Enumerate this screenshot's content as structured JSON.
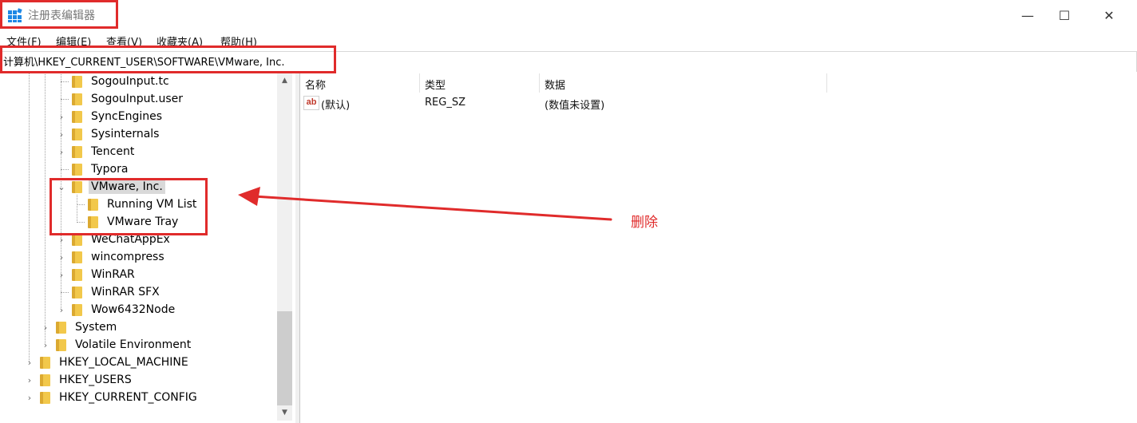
{
  "window": {
    "title": "注册表编辑器",
    "minimize_glyph": "—",
    "maximize_glyph": "☐",
    "close_glyph": "✕"
  },
  "menu": [
    {
      "label": "文件(F)"
    },
    {
      "label": "编辑(E)"
    },
    {
      "label": "查看(V)"
    },
    {
      "label": "收藏夹(A)"
    },
    {
      "label": "帮助(H)"
    }
  ],
  "address": {
    "path": "计算机\\HKEY_CURRENT_USER\\SOFTWARE\\VMware, Inc."
  },
  "tree": {
    "items": [
      {
        "label": "SogouInput.tc",
        "expander": ""
      },
      {
        "label": "SogouInput.user",
        "expander": ""
      },
      {
        "label": "SyncEngines",
        "expander": "›"
      },
      {
        "label": "Sysinternals",
        "expander": "›"
      },
      {
        "label": "Tencent",
        "expander": "›"
      },
      {
        "label": "Typora",
        "expander": ""
      },
      {
        "label": "VMware, Inc.",
        "expander": "⌄",
        "selected": true
      },
      {
        "label": "Running VM List",
        "expander": ""
      },
      {
        "label": "VMware Tray",
        "expander": ""
      },
      {
        "label": "WeChatAppEx",
        "expander": "›"
      },
      {
        "label": "wincompress",
        "expander": "›"
      },
      {
        "label": "WinRAR",
        "expander": "›"
      },
      {
        "label": "WinRAR SFX",
        "expander": ""
      },
      {
        "label": "Wow6432Node",
        "expander": "›"
      },
      {
        "label": "System",
        "expander": "›"
      },
      {
        "label": "Volatile Environment",
        "expander": "›"
      },
      {
        "label": "HKEY_LOCAL_MACHINE",
        "expander": "›"
      },
      {
        "label": "HKEY_USERS",
        "expander": "›"
      },
      {
        "label": "HKEY_CURRENT_CONFIG",
        "expander": "›"
      }
    ]
  },
  "list": {
    "columns": [
      "名称",
      "类型",
      "数据"
    ],
    "rows": [
      {
        "icon": "ab",
        "name": "(默认)",
        "type": "REG_SZ",
        "data": "(数值未设置)"
      }
    ]
  },
  "annotation": {
    "label": "删除"
  },
  "colors": {
    "annotation_red": "#e02b2b",
    "folder_yellow": "#f2c84b",
    "selection_gray": "#d9d9d9"
  }
}
